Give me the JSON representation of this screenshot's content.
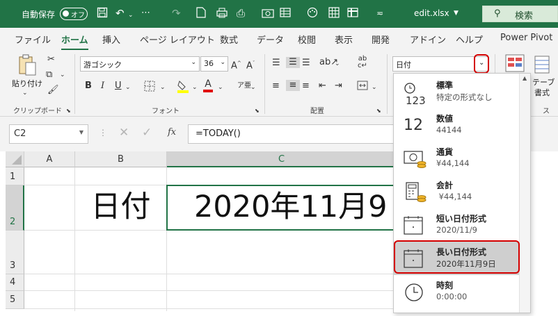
{
  "title_bar": {
    "autosave_label": "自動保存",
    "autosave_toggle": "オフ",
    "filename": "edit.xlsx",
    "search_label": "検索"
  },
  "menu": {
    "tabs": [
      "ファイル",
      "ホーム",
      "挿入",
      "ページ レイアウト",
      "数式",
      "データ",
      "校閲",
      "表示",
      "開発",
      "アドイン",
      "ヘルプ",
      "Power Pivot"
    ],
    "active": "ホーム"
  },
  "ribbon": {
    "clipboard": {
      "paste_label": "貼り付け",
      "group_label": "クリップボード"
    },
    "font": {
      "name": "游ゴシック",
      "size": "36",
      "group_label": "フォント",
      "bold": "B",
      "italic": "I",
      "underline": "U",
      "font_color_letter": "A"
    },
    "alignment": {
      "group_label": "配置"
    },
    "number": {
      "format_value": "日付"
    },
    "table": {
      "partial_label_1": "テーブ",
      "partial_label_2": "書式",
      "partial_label_3": "ス"
    }
  },
  "formula_bar": {
    "name_box": "C2",
    "fx": "fx",
    "formula": "=TODAY()"
  },
  "sheet": {
    "columns": [
      "A",
      "B",
      "C"
    ],
    "rows": [
      "1",
      "2",
      "3",
      "4",
      "5"
    ],
    "selected_column": "C",
    "selected_row": "2",
    "cells": {
      "B2": "日付",
      "C2": "2020年11月9"
    }
  },
  "format_dropdown": {
    "options": [
      {
        "name": "標準",
        "example": "特定の形式なし",
        "icon": "clock-123-icon"
      },
      {
        "name": "数値",
        "example": "44144",
        "icon": "number-12-icon"
      },
      {
        "name": "通貨",
        "example": "¥44,144",
        "icon": "currency-icon"
      },
      {
        "name": "会計",
        "example": " ¥44,144",
        "icon": "accounting-icon"
      },
      {
        "name": "短い日付形式",
        "example": "2020/11/9",
        "icon": "calendar-icon"
      },
      {
        "name": "長い日付形式",
        "example": "2020年11月9日",
        "icon": "calendar-icon"
      },
      {
        "name": "時刻",
        "example": "0:00:00",
        "icon": "clock-icon"
      }
    ],
    "highlighted_index": 5
  },
  "colors": {
    "accent": "#217346",
    "highlight_red": "#d40000"
  }
}
